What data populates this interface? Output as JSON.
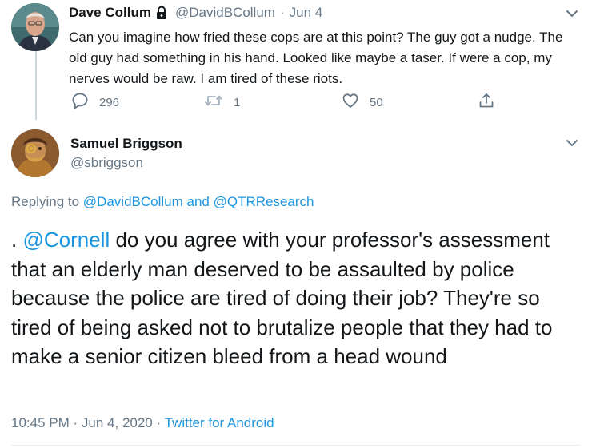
{
  "parent_tweet": {
    "author_name": "Dave Collum",
    "handle": "@DavidBCollum",
    "separator": "·",
    "date": "Jun 4",
    "text": "Can you imagine how fried these cops are at this point? The guy got a nudge. The old guy had something in his hand. Looked like maybe a taser. If were a cop, my nerves would be raw. I am tired of these riots.",
    "replies": "296",
    "retweets": "1",
    "likes": "50",
    "protected_icon": "lock-icon"
  },
  "main_tweet": {
    "author_name": "Samuel Briggson",
    "handle": "@sbriggson",
    "replying_prefix": "Replying to",
    "replying_to_1": "@DavidBCollum",
    "replying_and": "and",
    "replying_to_2": "@QTRResearch",
    "text_prefix": ". ",
    "mention": "@Cornell",
    "text_rest": " do you agree with your professor's assessment that an elderly man deserved to be assaulted by police because the police are tired of doing their job? They're so tired of being asked not to brutalize people that they had to make a senior citizen bleed from a head wound",
    "time": "10:45 PM",
    "meta_separator_1": "·",
    "date": "Jun 4, 2020",
    "meta_separator_2": "·",
    "source": "Twitter for Android"
  },
  "colors": {
    "link": "#1b95e0",
    "secondary_text": "#657786",
    "primary_text": "#14171a",
    "divider": "#e6ecf0"
  }
}
